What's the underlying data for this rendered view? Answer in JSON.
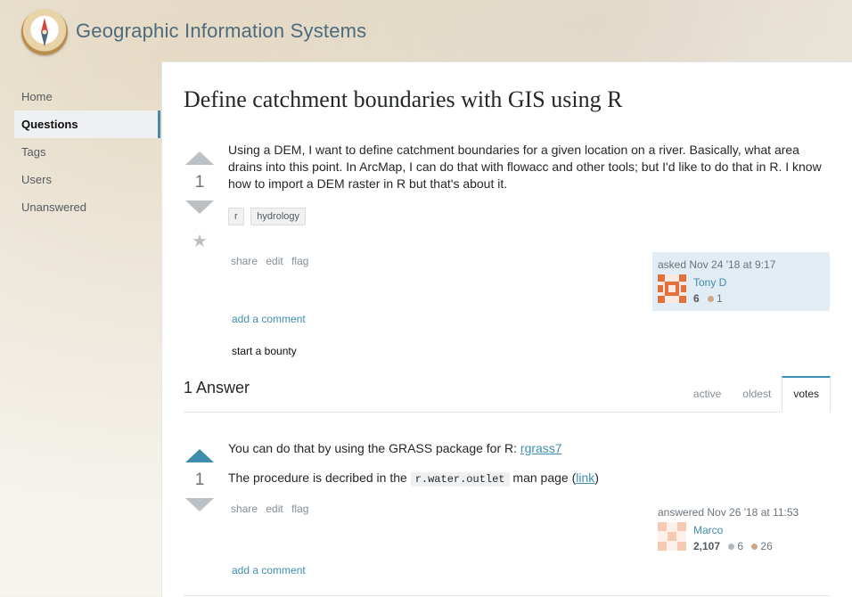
{
  "site": {
    "title": "Geographic Information Systems"
  },
  "nav": {
    "items": [
      {
        "label": "Home",
        "active": false
      },
      {
        "label": "Questions",
        "active": true
      },
      {
        "label": "Tags",
        "active": false
      },
      {
        "label": "Users",
        "active": false
      },
      {
        "label": "Unanswered",
        "active": false
      }
    ]
  },
  "question": {
    "title": "Define catchment boundaries with GIS using R",
    "votes": "1",
    "body": "Using a DEM, I want to define catchment boundaries for a given location on a river. Basically, what area drains into this point. In ArcMap, I can do that with flowacc and other tools; but I'd like to do that in R. I know how to import a DEM raster in R but that's about it.",
    "tags": [
      "r",
      "hydrology"
    ],
    "menu": [
      "share",
      "edit",
      "flag"
    ],
    "asked": "asked Nov 24 '18 at 9:17",
    "user": {
      "name": "Tony D",
      "rep": "6",
      "bronze": "1"
    },
    "add_comment": "add a comment",
    "bounty": "start a bounty"
  },
  "answers_header": {
    "count_label": "1 Answer",
    "tabs": [
      "active",
      "oldest",
      "votes"
    ],
    "active_tab": "votes"
  },
  "answer": {
    "votes": "1",
    "line1_prefix": "You can do that by using the GRASS package for R: ",
    "line1_link": "rgrass7",
    "line2_prefix": "The procedure is decribed in the ",
    "line2_code": "r.water.outlet",
    "line2_mid": " man page (",
    "line2_link": "link",
    "line2_suffix": ")",
    "menu": [
      "share",
      "edit",
      "flag"
    ],
    "answered": "answered Nov 26 '18 at 11:53",
    "user": {
      "name": "Marco",
      "rep": "2,107",
      "silver": "6",
      "bronze": "26"
    },
    "add_comment": "add a comment"
  },
  "colors": {
    "accent": "#3d8eae",
    "vote_active": "#3d8eae",
    "owner_bg": "#e1ecf4"
  }
}
